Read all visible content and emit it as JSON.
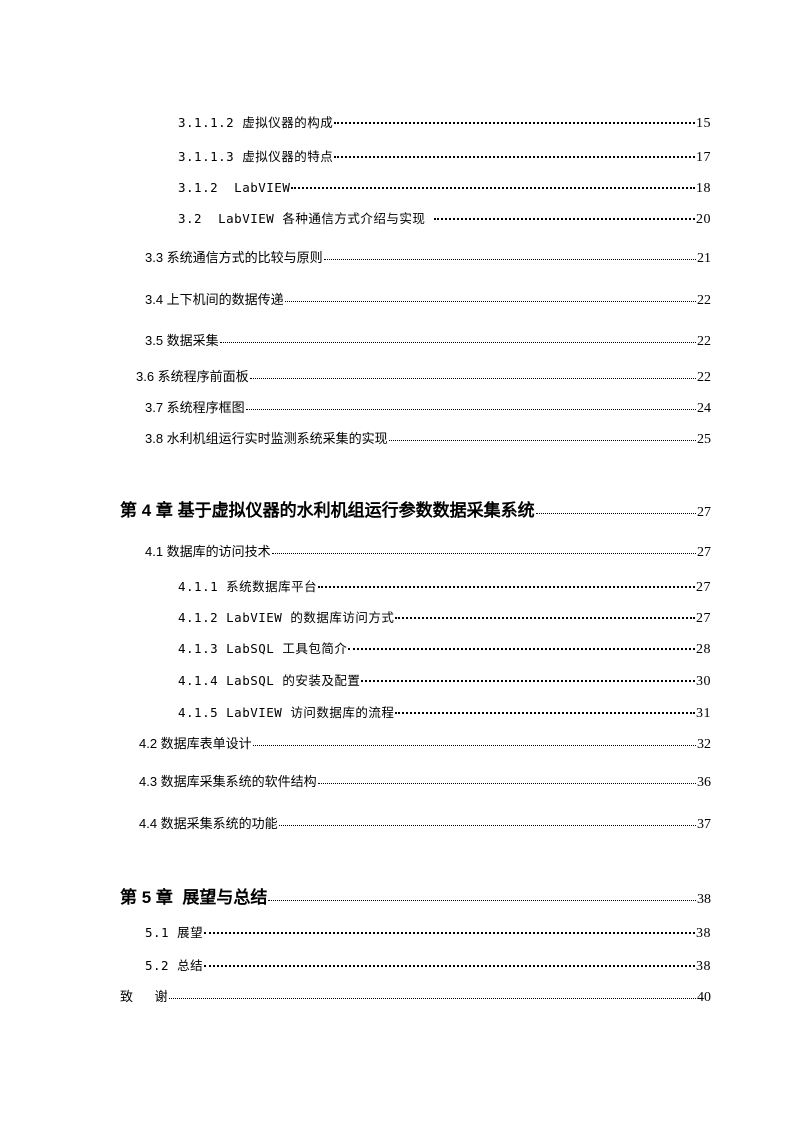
{
  "toc": {
    "entries": [
      {
        "title": "3.1.1.2 虚拟仪器的构成",
        "page": "15"
      },
      {
        "title": "3.1.1.3 虚拟仪器的特点",
        "page": "17"
      },
      {
        "title": "3.1.2  LabVIEW",
        "page": "18"
      },
      {
        "title": "3.2  LabVIEW 各种通信方式介绍与实现 ",
        "page": "20"
      },
      {
        "title": "3.3 系统通信方式的比较与原则",
        "page": "21"
      },
      {
        "title": "3.4 上下机间的数据传递",
        "page": "22"
      },
      {
        "title": "3.5 数据采集",
        "page": "22"
      },
      {
        "title": "3.6 系统程序前面板",
        "page": "22"
      },
      {
        "title": "3.7 系统程序框图",
        "page": "24"
      },
      {
        "title": "3.8 水利机组运行实时监测系统采集的实现",
        "page": "25"
      },
      {
        "title": "第 4 章 基于虚拟仪器的水利机组运行参数数据采集系统",
        "page": "27"
      },
      {
        "title": "4.1 数据库的访问技术 ",
        "page": "27"
      },
      {
        "title": "4.1.1 系统数据库平台",
        "page": "27"
      },
      {
        "title": "4.1.2 LabVIEW 的数据库访问方式",
        "page": "27"
      },
      {
        "title": "4.1.3 LabSQL 工具包简介 ",
        "page": "28"
      },
      {
        "title": "4.1.4 LabSQL 的安装及配置 ",
        "page": "30"
      },
      {
        "title": "4.1.5 LabVIEW 访问数据库的流程 ",
        "page": "31"
      },
      {
        "title": "4.2 数据库表单设计 ",
        "page": "32"
      },
      {
        "title": "4.3 数据库采集系统的软件结构 ",
        "page": "36"
      },
      {
        "title": "4.4 数据采集系统的功能 ",
        "page": "37"
      },
      {
        "title": "第 5 章  展望与总结",
        "page": "38"
      },
      {
        "title": "5.1 展望",
        "page": "38"
      },
      {
        "title": "5.2 总结 ",
        "page": "38"
      },
      {
        "title": "致      谢",
        "page": "40"
      }
    ]
  }
}
